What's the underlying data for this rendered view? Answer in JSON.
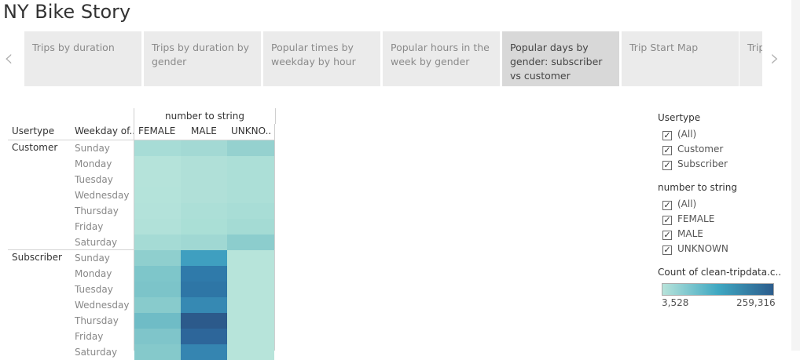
{
  "page": {
    "title": "NY Bike Story"
  },
  "nav": {
    "prev_icon": "‹",
    "next_icon": "›"
  },
  "tabs": [
    {
      "label": "Trips by duration",
      "active": false
    },
    {
      "label": "Trips by duration by gender",
      "active": false
    },
    {
      "label": "Popular times by weekday by hour",
      "active": false
    },
    {
      "label": "Popular hours in the week by gender",
      "active": false
    },
    {
      "label": "Popular days by gender: subscriber vs customer",
      "active": true
    },
    {
      "label": "Trip Start Map",
      "active": false
    },
    {
      "label": "Trip",
      "active": false
    }
  ],
  "heatmap": {
    "column_group_label": "number to string",
    "row_header_usertype": "Usertype",
    "row_header_weekday": "Weekday of..",
    "columns": [
      "FEMALE",
      "MALE",
      "UNKNO.."
    ],
    "groups": [
      {
        "label": "Customer",
        "rows": [
          {
            "day": "Sunday",
            "colors": [
              "#a7dcd6",
              "#a3d9d4",
              "#95d1cf"
            ]
          },
          {
            "day": "Monday",
            "colors": [
              "#b5e3da",
              "#b0e0d8",
              "#acdfd7"
            ]
          },
          {
            "day": "Tuesday",
            "colors": [
              "#b5e3da",
              "#b0e0d8",
              "#acdfd7"
            ]
          },
          {
            "day": "Wednesday",
            "colors": [
              "#b4e3da",
              "#b0e0d8",
              "#acdfd7"
            ]
          },
          {
            "day": "Thursday",
            "colors": [
              "#b3e2da",
              "#acdfd7",
              "#a8ddd6"
            ]
          },
          {
            "day": "Friday",
            "colors": [
              "#b1e1d9",
              "#aadfd6",
              "#a4dbd4"
            ]
          },
          {
            "day": "Saturday",
            "colors": [
              "#a5dbd5",
              "#a0d8d3",
              "#8ccdcd"
            ]
          }
        ]
      },
      {
        "label": "Subscriber",
        "rows": [
          {
            "day": "Sunday",
            "colors": [
              "#8fcfce",
              "#3f9fc0",
              "#b7e4da"
            ]
          },
          {
            "day": "Monday",
            "colors": [
              "#7ec6ca",
              "#2f7aaa",
              "#b7e4da"
            ]
          },
          {
            "day": "Tuesday",
            "colors": [
              "#7cc4c9",
              "#2e76a6",
              "#b7e4da"
            ]
          },
          {
            "day": "Wednesday",
            "colors": [
              "#88cbcc",
              "#3689b3",
              "#b7e4da"
            ]
          },
          {
            "day": "Thursday",
            "colors": [
              "#6fbcc6",
              "#2c5a8b",
              "#b7e4da"
            ]
          },
          {
            "day": "Friday",
            "colors": [
              "#7fc5ca",
              "#2d669a",
              "#b7e4da"
            ]
          },
          {
            "day": "Saturday",
            "colors": [
              "#85c9cb",
              "#3585b1",
              "#b7e4da"
            ]
          }
        ]
      }
    ]
  },
  "filters": {
    "usertype": {
      "title": "Usertype",
      "items": [
        "(All)",
        "Customer",
        "Subscriber"
      ]
    },
    "gender": {
      "title": "number to string",
      "items": [
        "(All)",
        "FEMALE",
        "MALE",
        "UNKNOWN"
      ]
    }
  },
  "legend": {
    "title": "Count of clean-tripdata.c..",
    "min": "3,528",
    "max": "259,316",
    "colors": {
      "low": "#b7e3da",
      "mid": "#3fa8c2",
      "high": "#2c5c8c"
    }
  },
  "colors": {
    "active_tab_bg": "#d8d8d8",
    "tab_bg": "#ebebeb"
  }
}
